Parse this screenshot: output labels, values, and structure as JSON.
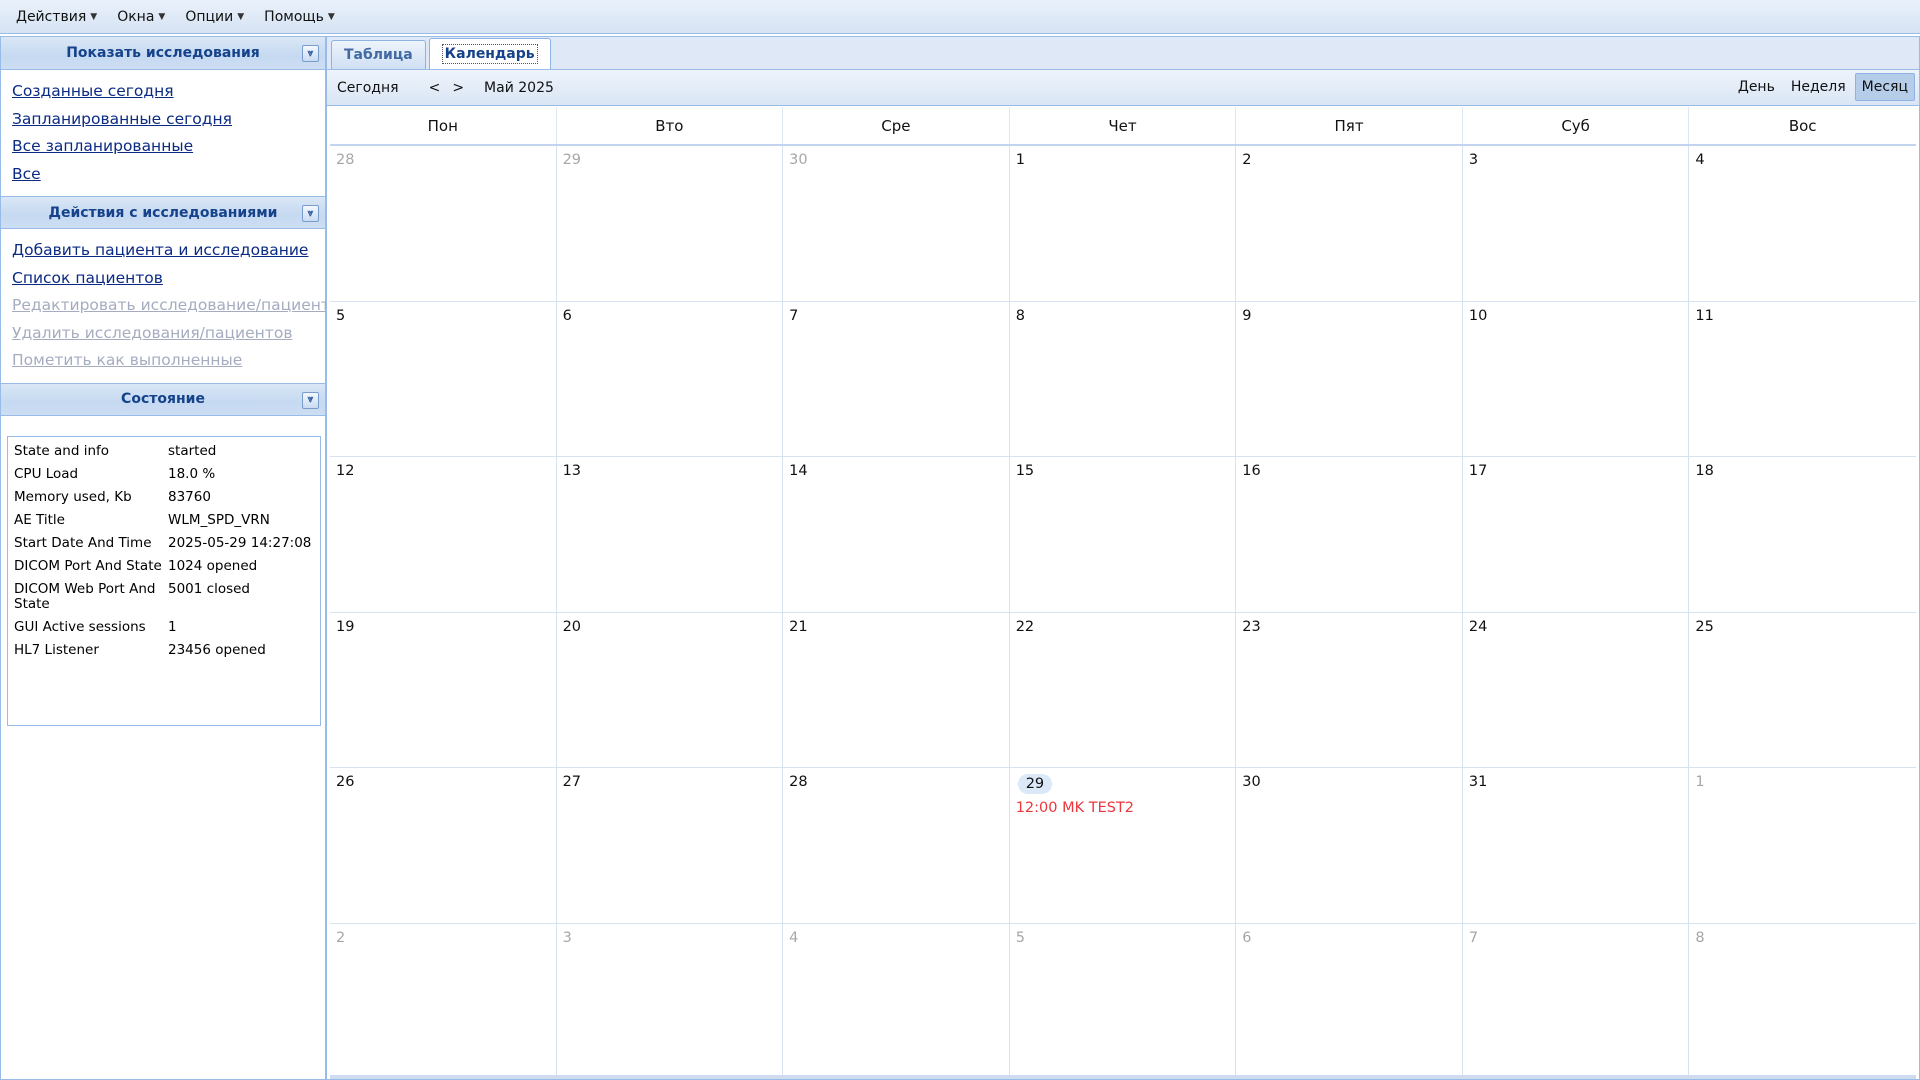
{
  "menubar": {
    "items": [
      {
        "label": "Действия"
      },
      {
        "label": "Окна"
      },
      {
        "label": "Опции"
      },
      {
        "label": "Помощь"
      }
    ]
  },
  "left": {
    "show_panel": {
      "title": "Показать исследования",
      "links": [
        "Созданные сегодня",
        "Запланированные сегодня",
        "Все запланированные",
        "Все"
      ]
    },
    "actions_panel": {
      "title": "Действия с исследованиями",
      "links": [
        {
          "label": "Добавить пациента и исследование",
          "disabled": false
        },
        {
          "label": "Список пациентов",
          "disabled": false
        },
        {
          "label": "Редактировать исследование/пациента",
          "disabled": true
        },
        {
          "label": "Удалить исследования/пациентов",
          "disabled": true
        },
        {
          "label": "Пометить как выполненные",
          "disabled": true
        }
      ]
    },
    "status_panel": {
      "title": "Состояние",
      "rows": [
        {
          "k": "State and info",
          "v": "started"
        },
        {
          "k": "CPU Load",
          "v": "18.0 %"
        },
        {
          "k": "Memory used, Kb",
          "v": "83760"
        },
        {
          "k": "AE Title",
          "v": "WLM_SPD_VRN"
        },
        {
          "k": "Start Date And Time",
          "v": "2025-05-29 14:27:08"
        },
        {
          "k": "DICOM Port And State",
          "v": "1024 opened"
        },
        {
          "k": "DICOM Web Port And State",
          "v": "5001 closed"
        },
        {
          "k": "GUI Active sessions",
          "v": "1"
        },
        {
          "k": "HL7 Listener",
          "v": "23456 opened"
        }
      ]
    }
  },
  "tabs": {
    "table": "Таблица",
    "calendar": "Календарь"
  },
  "calendar": {
    "today_label": "Сегодня",
    "prev": "<",
    "next": ">",
    "title": "Май 2025",
    "views": {
      "day": "День",
      "week": "Неделя",
      "month": "Месяц"
    },
    "dow": [
      "Пон",
      "Вто",
      "Сре",
      "Чет",
      "Пят",
      "Суб",
      "Вос"
    ],
    "weeks": [
      [
        {
          "n": "28",
          "o": true
        },
        {
          "n": "29",
          "o": true
        },
        {
          "n": "30",
          "o": true
        },
        {
          "n": "1"
        },
        {
          "n": "2"
        },
        {
          "n": "3"
        },
        {
          "n": "4"
        }
      ],
      [
        {
          "n": "5"
        },
        {
          "n": "6"
        },
        {
          "n": "7"
        },
        {
          "n": "8"
        },
        {
          "n": "9"
        },
        {
          "n": "10"
        },
        {
          "n": "11"
        }
      ],
      [
        {
          "n": "12"
        },
        {
          "n": "13"
        },
        {
          "n": "14"
        },
        {
          "n": "15"
        },
        {
          "n": "16"
        },
        {
          "n": "17"
        },
        {
          "n": "18"
        }
      ],
      [
        {
          "n": "19"
        },
        {
          "n": "20"
        },
        {
          "n": "21"
        },
        {
          "n": "22"
        },
        {
          "n": "23"
        },
        {
          "n": "24"
        },
        {
          "n": "25"
        }
      ],
      [
        {
          "n": "26"
        },
        {
          "n": "27"
        },
        {
          "n": "28"
        },
        {
          "n": "29",
          "today": true,
          "events": [
            "12:00 MK TEST2"
          ]
        },
        {
          "n": "30"
        },
        {
          "n": "31"
        },
        {
          "n": "1",
          "o": true
        }
      ],
      [
        {
          "n": "2",
          "o": true
        },
        {
          "n": "3",
          "o": true
        },
        {
          "n": "4",
          "o": true
        },
        {
          "n": "5",
          "o": true
        },
        {
          "n": "6",
          "o": true
        },
        {
          "n": "7",
          "o": true
        },
        {
          "n": "8",
          "o": true
        }
      ]
    ],
    "event_color": "#e8383d"
  }
}
